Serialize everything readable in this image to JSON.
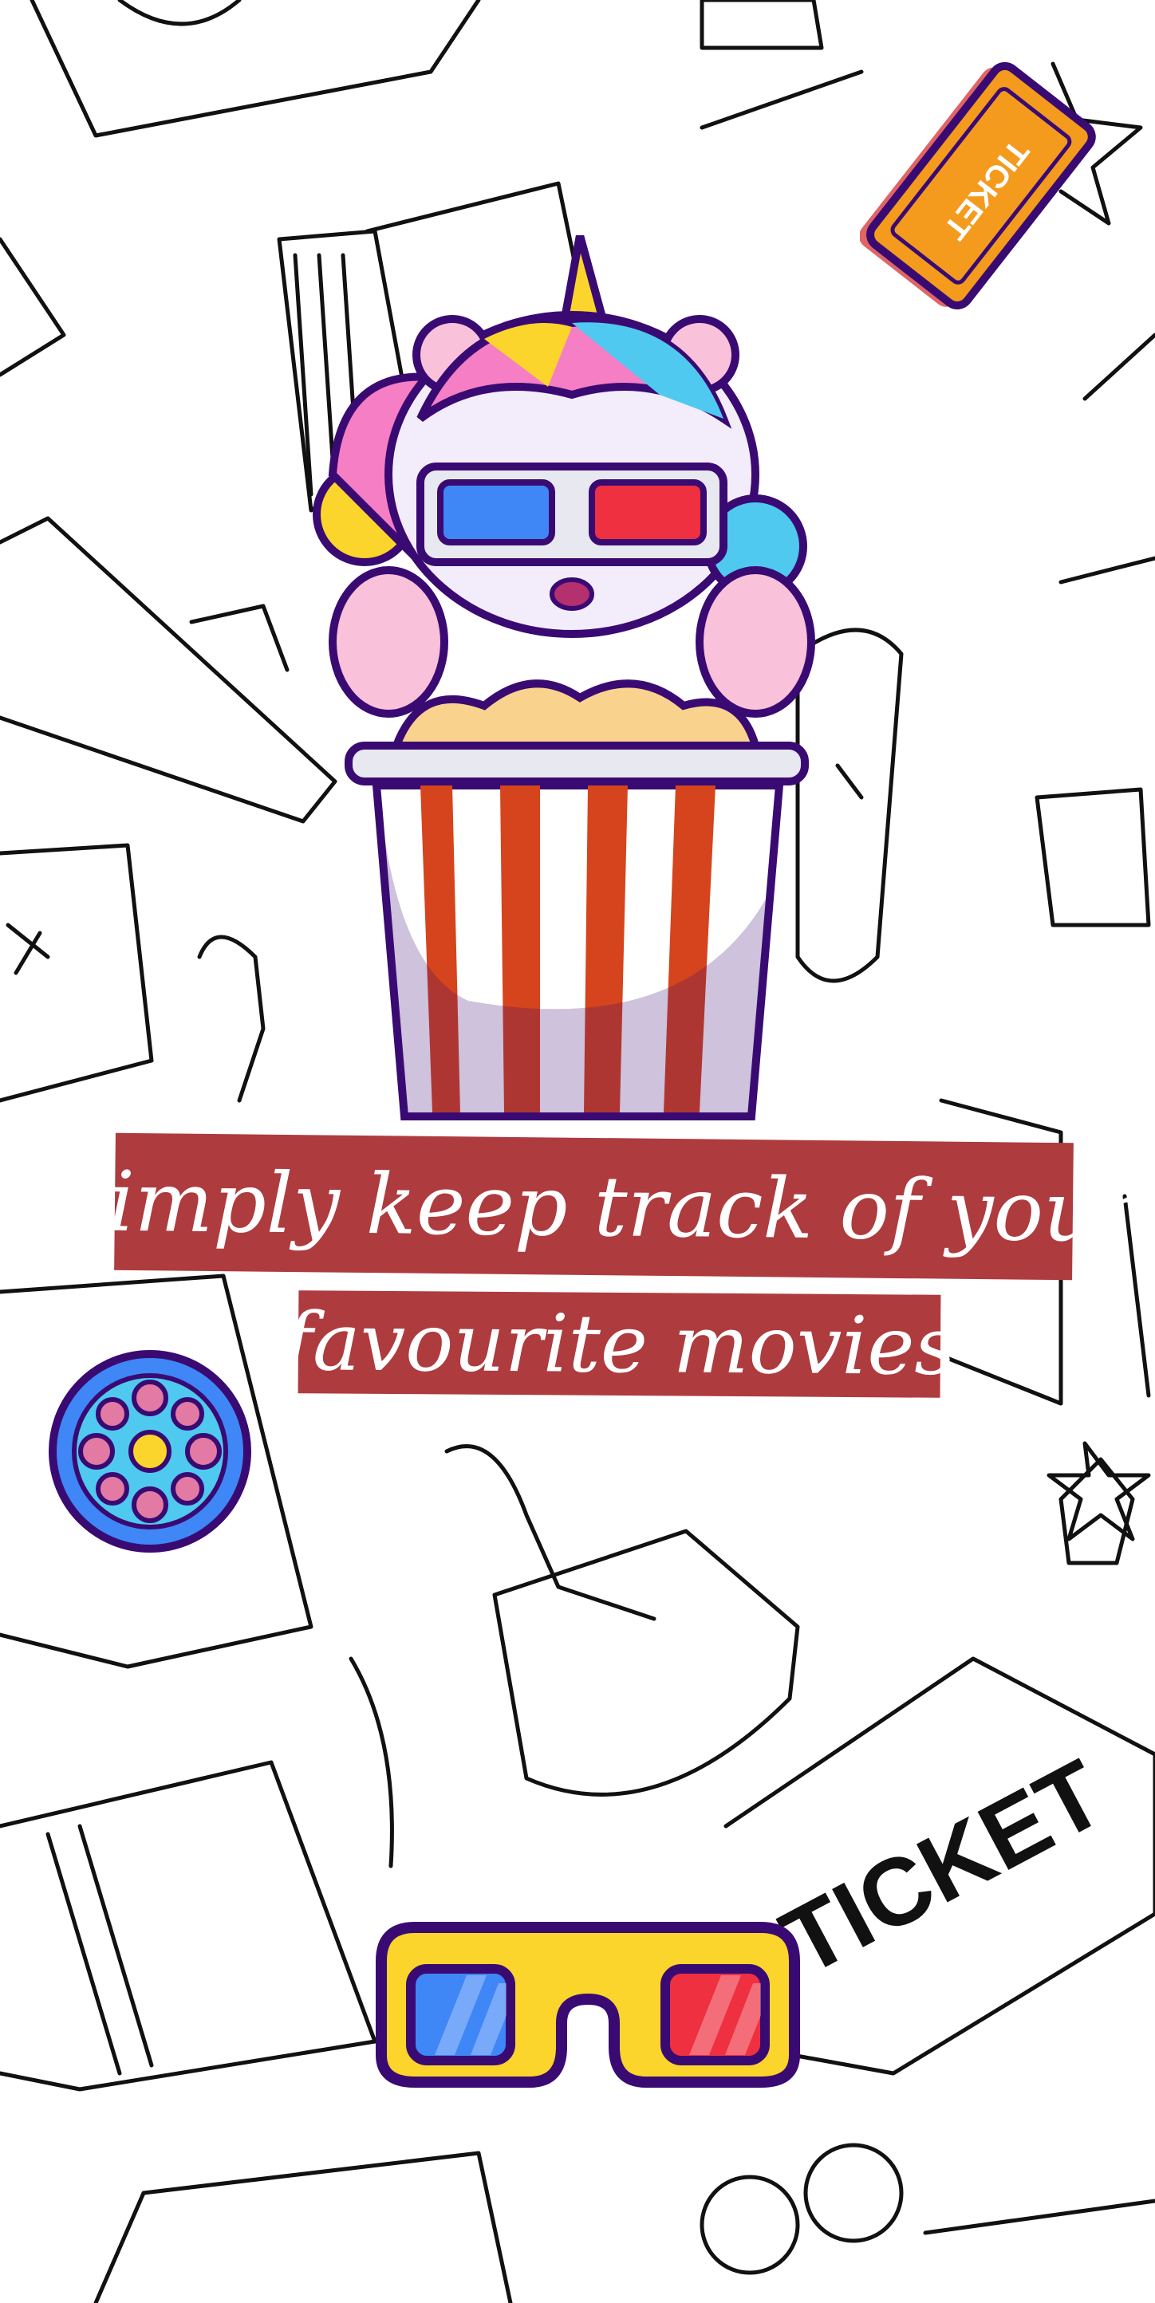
{
  "tagline": {
    "line1": "Simply keep track of your",
    "line2": "favourite movies"
  },
  "decor": {
    "ticket_small": "TICKET",
    "ticket_large": "TICKET"
  },
  "colors": {
    "banner": "#ae3b3e",
    "glasses_frame": "#fbd52b",
    "outline": "#3a0a73",
    "lens_blue": "#3f86f7",
    "lens_red": "#ee3040",
    "popcorn_stripe": "#d5441c"
  },
  "icons": [
    "unicorn-popcorn-illustration",
    "film-reel-icon",
    "3d-glasses-icon",
    "ticket-icon"
  ]
}
